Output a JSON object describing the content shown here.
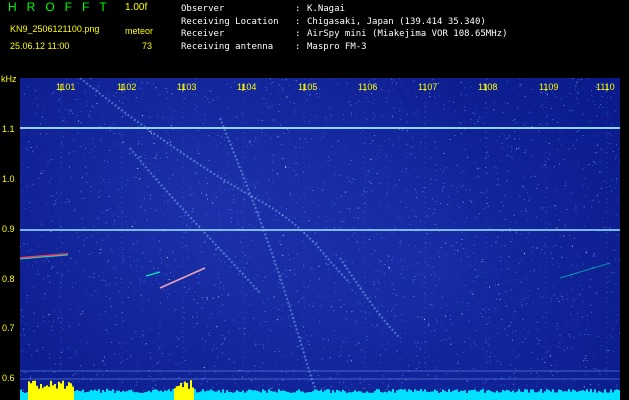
{
  "header": {
    "app_title": "HROFFT",
    "version": "1.00f",
    "filename": "KN9_2506121100.png",
    "mode": "meteor",
    "datetime": "25.06.12 11:00",
    "count": "73",
    "info": [
      {
        "label": "Observer",
        "value": "K.Nagai"
      },
      {
        "label": "Receiving Location",
        "value": "Chigasaki, Japan (139.414 35.340)"
      },
      {
        "label": "Receiver",
        "value": "AirSpy mini (Miakejima VOR 108.65MHz)"
      },
      {
        "label": "Receiving antenna",
        "value": "Maspro FM-3"
      }
    ]
  },
  "spectrogram": {
    "y_unit": "kHz",
    "y_ticks": [
      "1.1",
      "1.0",
      "0.9",
      "0.8",
      "0.7",
      "0.6"
    ],
    "x_ticks": [
      "1101",
      "1102",
      "1103",
      "1104",
      "1105",
      "1106",
      "1107",
      "1108",
      "1109",
      "1110"
    ],
    "colors": {
      "background": "#0a1a8a",
      "noise": "#4a7cff",
      "line": "#9fe8ff",
      "meteor": "#ff4060",
      "echo": "#00ffc0",
      "bar_yellow": "#ffff00",
      "bar_cyan": "#00e0ff",
      "label": "#ffff00"
    }
  }
}
